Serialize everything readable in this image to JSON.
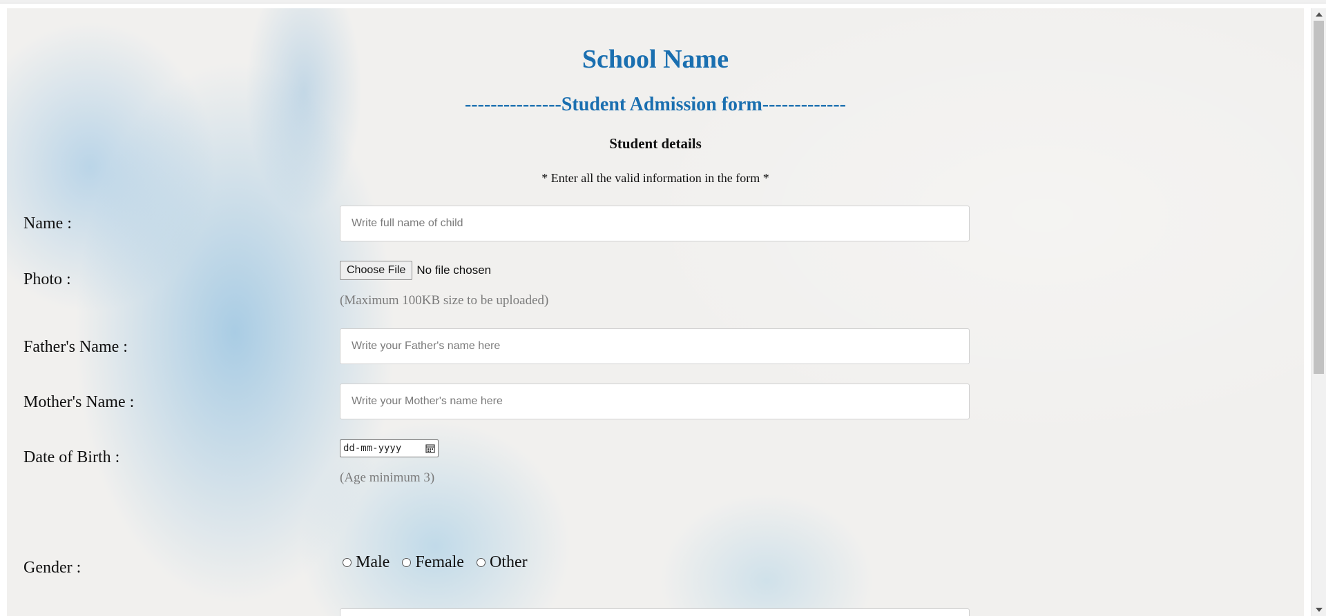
{
  "header": {
    "title": "School Name",
    "subtitle": "---------------Student Admission form-------------",
    "section": "Student details",
    "note": "* Enter all the valid information in the form *"
  },
  "form": {
    "name": {
      "label": "Name :",
      "placeholder": "Write full name of child"
    },
    "photo": {
      "label": "Photo :",
      "button": "Choose File",
      "status": "No file chosen",
      "hint": "(Maximum 100KB size to be uploaded)"
    },
    "father": {
      "label": "Father's Name :",
      "placeholder": "Write your Father's name here"
    },
    "mother": {
      "label": "Mother's Name :",
      "placeholder": "Write your Mother's name here"
    },
    "dob": {
      "label": "Date of Birth :",
      "placeholder": "dd-mm-yyyy",
      "hint": "(Age minimum 3)",
      "icon": "calendar-icon"
    },
    "gender": {
      "label": "Gender :",
      "options": [
        "Male",
        "Female",
        "Other"
      ]
    }
  },
  "colors": {
    "accent": "#1a6fb0",
    "hint": "#7b7b7b",
    "background": "#f1f0ee"
  }
}
